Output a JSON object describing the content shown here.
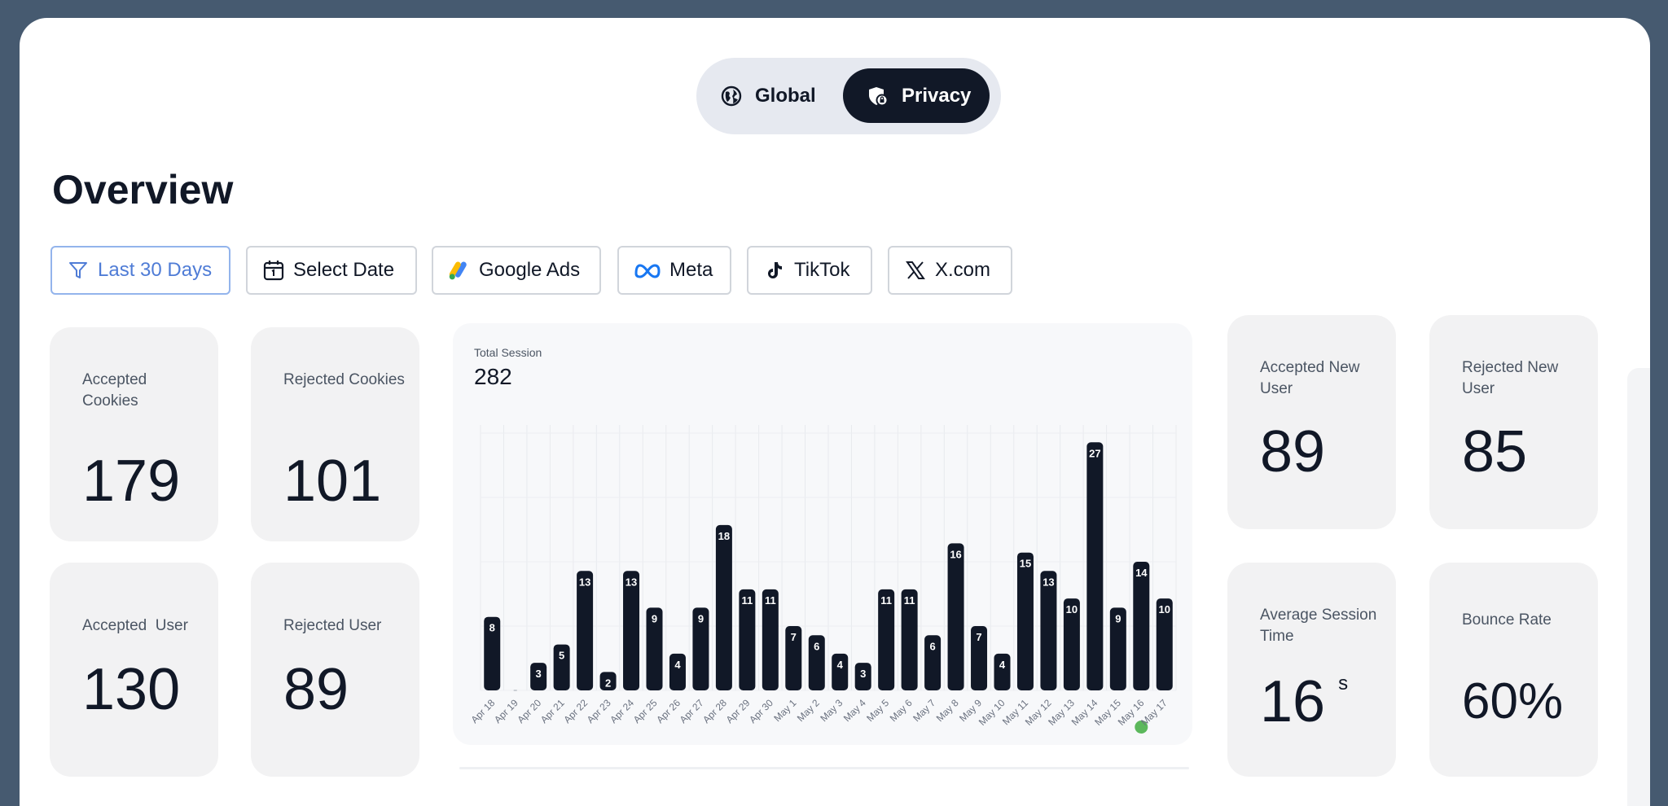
{
  "toggle": {
    "global_label": "Global",
    "privacy_label": "Privacy",
    "active": "Privacy"
  },
  "page_title": "Overview",
  "filters": {
    "last30": "Last 30 Days",
    "select_date": "Select Date",
    "google_ads": "Google Ads",
    "meta": "Meta",
    "tiktok": "TikTok",
    "xcom": "X.com"
  },
  "cards": {
    "accepted_cookies": {
      "label": "Accepted Cookies",
      "value": "179"
    },
    "rejected_cookies": {
      "label": "Rejected Cookies",
      "value": "101"
    },
    "accepted_user": {
      "label": "Accepted  User",
      "value": "130"
    },
    "rejected_user": {
      "label": "Rejected User",
      "value": "89"
    },
    "accepted_new_user": {
      "label": "Accepted New User",
      "value": "89"
    },
    "rejected_new_user": {
      "label": "Rejected New User",
      "value": "85"
    },
    "avg_session_time": {
      "label": "Average Session Time",
      "value": "16",
      "unit": "s"
    },
    "bounce_rate": {
      "label": "Bounce Rate",
      "value": "60%"
    }
  },
  "colors": {
    "bar": "#111827",
    "accent": "#4f7cd6",
    "marker": "#5cb85c"
  },
  "chart_data": {
    "type": "bar",
    "subtitle": "Total Session",
    "total": "282",
    "categories": [
      "Apr 18",
      "Apr 19",
      "Apr 20",
      "Apr 21",
      "Apr 22",
      "Apr 23",
      "Apr 24",
      "Apr 25",
      "Apr 26",
      "Apr 27",
      "Apr 28",
      "Apr 29",
      "Apr 30",
      "May 1",
      "May 2",
      "May 3",
      "May 4",
      "May 5",
      "May 6",
      "May 7",
      "May 8",
      "May 9",
      "May 10",
      "May 11",
      "May 12",
      "May 13",
      "May 14",
      "May 15",
      "May 16",
      "May 17"
    ],
    "values": [
      8,
      0,
      3,
      5,
      13,
      2,
      13,
      9,
      4,
      9,
      18,
      11,
      11,
      7,
      6,
      4,
      3,
      11,
      11,
      6,
      16,
      7,
      4,
      15,
      13,
      10,
      27,
      9,
      14,
      10
    ],
    "ylim": [
      0,
      28
    ],
    "grid": true,
    "highlight_category": "May 16"
  }
}
